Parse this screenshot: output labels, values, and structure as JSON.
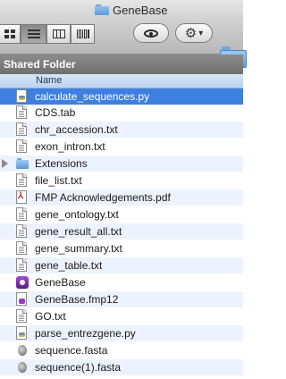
{
  "window": {
    "title": "GeneBase"
  },
  "toolbar": {
    "view_modes": [
      "icon-view-icon",
      "list-view-icon",
      "column-view-icon",
      "coverflow-view-icon"
    ],
    "active_view": "list-view-icon",
    "quicklook_icon": "eye-icon",
    "action_icon": "gear-icon",
    "action_menu_arrow": "▾",
    "new_folder_icon": "new-folder-icon"
  },
  "section": {
    "label": "Shared Folder"
  },
  "list_header": {
    "name_label": "Name"
  },
  "files": [
    {
      "name": "calculate_sequences.py",
      "icon": "python-script-icon",
      "selected": true
    },
    {
      "name": "CDS.tab",
      "icon": "text-document-icon"
    },
    {
      "name": "chr_accession.txt",
      "icon": "text-document-icon"
    },
    {
      "name": "exon_intron.txt",
      "icon": "text-document-icon"
    },
    {
      "name": "Extensions",
      "icon": "folder-icon",
      "disclosure": "collapsed"
    },
    {
      "name": "file_list.txt",
      "icon": "text-document-icon"
    },
    {
      "name": "FMP Acknowledgements.pdf",
      "icon": "pdf-icon"
    },
    {
      "name": "gene_ontology.txt",
      "icon": "text-document-icon"
    },
    {
      "name": "gene_result_all.txt",
      "icon": "text-document-icon"
    },
    {
      "name": "gene_summary.txt",
      "icon": "text-document-icon"
    },
    {
      "name": "gene_table.txt",
      "icon": "text-document-icon"
    },
    {
      "name": "GeneBase",
      "icon": "filemaker-app-icon"
    },
    {
      "name": "GeneBase.fmp12",
      "icon": "filemaker-document-icon"
    },
    {
      "name": "GO.txt",
      "icon": "text-document-icon"
    },
    {
      "name": "parse_entrezgene.py",
      "icon": "python-script-icon"
    },
    {
      "name": "sequence.fasta",
      "icon": "fasta-icon"
    },
    {
      "name": "sequence(1).fasta",
      "icon": "fasta-icon"
    }
  ]
}
